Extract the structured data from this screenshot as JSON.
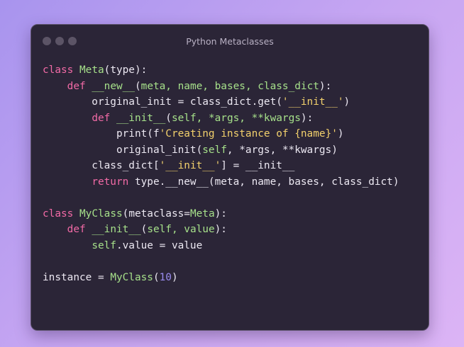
{
  "window": {
    "title": "Python Metaclasses"
  },
  "code_lines": [
    [
      [
        "kw",
        "class"
      ],
      [
        "plain",
        " "
      ],
      [
        "cls",
        "Meta"
      ],
      [
        "plain",
        "(type):"
      ]
    ],
    [
      [
        "plain",
        "    "
      ],
      [
        "kw",
        "def"
      ],
      [
        "plain",
        " "
      ],
      [
        "fn",
        "__new__"
      ],
      [
        "plain",
        "("
      ],
      [
        "param",
        "meta, name, bases, class_dict"
      ],
      [
        "plain",
        "):"
      ]
    ],
    [
      [
        "plain",
        "        original_init = class_dict.get("
      ],
      [
        "str",
        "'__init__'"
      ],
      [
        "plain",
        ")"
      ]
    ],
    [
      [
        "plain",
        "        "
      ],
      [
        "kw",
        "def"
      ],
      [
        "plain",
        " "
      ],
      [
        "fn",
        "__init__"
      ],
      [
        "plain",
        "("
      ],
      [
        "param",
        "self, *args, **kwargs"
      ],
      [
        "plain",
        "):"
      ]
    ],
    [
      [
        "plain",
        "            print(f"
      ],
      [
        "str",
        "'Creating instance of {name}'"
      ],
      [
        "plain",
        ")"
      ]
    ],
    [
      [
        "plain",
        "            original_init("
      ],
      [
        "param",
        "self"
      ],
      [
        "plain",
        ", *args, **kwargs)"
      ]
    ],
    [
      [
        "plain",
        "        class_dict["
      ],
      [
        "str",
        "'__init__'"
      ],
      [
        "plain",
        "] = __init__"
      ]
    ],
    [
      [
        "plain",
        "        "
      ],
      [
        "kw",
        "return"
      ],
      [
        "plain",
        " type.__new__(meta, name, bases, class_dict)"
      ]
    ],
    [],
    [
      [
        "kw",
        "class"
      ],
      [
        "plain",
        " "
      ],
      [
        "cls",
        "MyClass"
      ],
      [
        "plain",
        "(metaclass="
      ],
      [
        "cls",
        "Meta"
      ],
      [
        "plain",
        "):"
      ]
    ],
    [
      [
        "plain",
        "    "
      ],
      [
        "kw",
        "def"
      ],
      [
        "plain",
        " "
      ],
      [
        "fn",
        "__init__"
      ],
      [
        "plain",
        "("
      ],
      [
        "param",
        "self, value"
      ],
      [
        "plain",
        "):"
      ]
    ],
    [
      [
        "plain",
        "        "
      ],
      [
        "param",
        "self"
      ],
      [
        "plain",
        ".value = value"
      ]
    ],
    [],
    [
      [
        "plain",
        "instance = "
      ],
      [
        "cls",
        "MyClass"
      ],
      [
        "plain",
        "("
      ],
      [
        "num",
        "10"
      ],
      [
        "plain",
        ")"
      ]
    ]
  ]
}
